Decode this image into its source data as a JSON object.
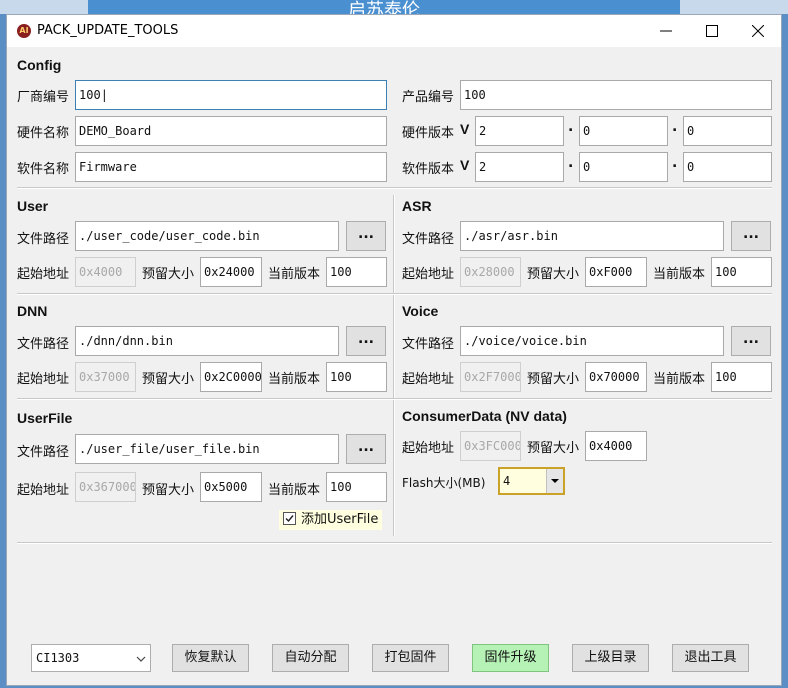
{
  "background": {
    "partial_text": "启苏泰伦"
  },
  "window": {
    "title": "PACK_UPDATE_TOOLS"
  },
  "config": {
    "heading": "Config",
    "vendor_label": "厂商编号",
    "vendor_value": "100",
    "product_label": "产品编号",
    "product_value": "100",
    "hw_name_label": "硬件名称",
    "hw_name_value": "DEMO_Board",
    "hw_ver_label": "硬件版本",
    "hw_ver_prefix": "V",
    "hw_ver": [
      "2",
      "0",
      "0"
    ],
    "sw_name_label": "软件名称",
    "sw_name_value": "Firmware",
    "sw_ver_label": "软件版本",
    "sw_ver_prefix": "V",
    "sw_ver": [
      "2",
      "0",
      "0"
    ],
    "dot": "."
  },
  "labels": {
    "path": "文件路径",
    "start": "起始地址",
    "reserve": "预留大小",
    "version": "当前版本",
    "browse": "..."
  },
  "user": {
    "heading": "User",
    "path": "./user_code/user_code.bin",
    "start": "0x4000",
    "reserve": "0x24000",
    "version": "100"
  },
  "asr": {
    "heading": "ASR",
    "path": "./asr/asr.bin",
    "start": "0x28000",
    "reserve": "0xF000",
    "version": "100"
  },
  "dnn": {
    "heading": "DNN",
    "path": "./dnn/dnn.bin",
    "start": "0x37000",
    "reserve": "0x2C0000",
    "version": "100"
  },
  "voice": {
    "heading": "Voice",
    "path": "./voice/voice.bin",
    "start": "0x2F7000",
    "reserve": "0x70000",
    "version": "100"
  },
  "userfile": {
    "heading": "UserFile",
    "path": "./user_file/user_file.bin",
    "start": "0x367000",
    "reserve": "0x5000",
    "version": "100",
    "checkbox_label": "添加UserFile",
    "checked": true
  },
  "consumer": {
    "heading": "ConsumerData (NV data)",
    "start": "0x3FC000",
    "reserve": "0x4000",
    "flash_label": "Flash大小(MB)",
    "flash_value": "4"
  },
  "footer": {
    "chip": "CI1303",
    "restore": "恢复默认",
    "auto": "自动分配",
    "pack": "打包固件",
    "upgrade": "固件升级",
    "parent": "上级目录",
    "exit": "退出工具"
  },
  "colors": {
    "upgrade_button": "#b6f2b6",
    "flash_combo_bg": "#ffffe0",
    "flash_combo_border": "#c9a227",
    "background_accent": "#4a8fd0"
  }
}
